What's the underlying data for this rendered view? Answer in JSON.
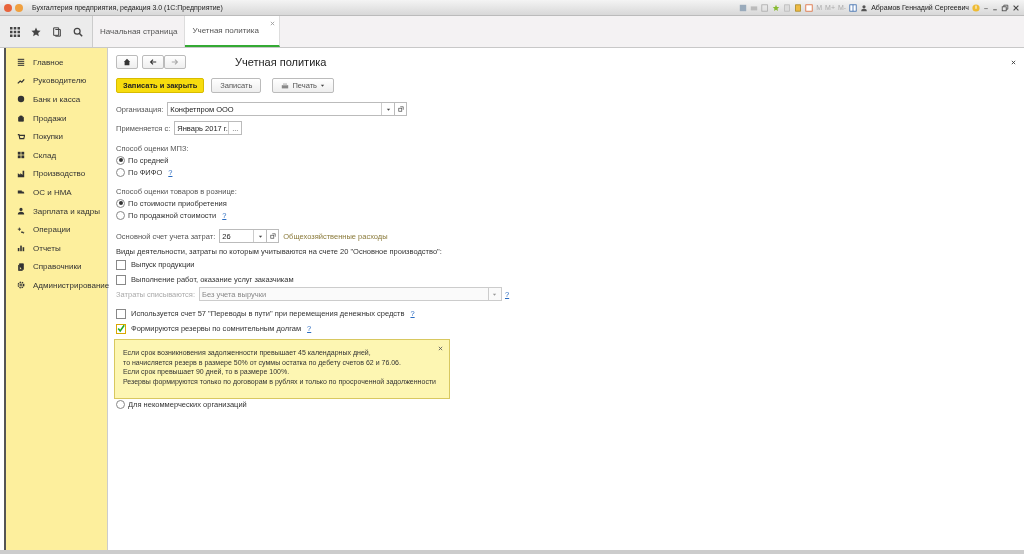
{
  "window": {
    "title": "Бухгалтерия предприятия, редакция 3.0  (1С:Предприятие)",
    "memory_buttons": [
      "M",
      "M+",
      "M-"
    ],
    "user": "Абрамов Геннадий Сергеевич"
  },
  "tabs": [
    {
      "label": "Начальная страница",
      "selected": false
    },
    {
      "label": "Учетная политика",
      "selected": true
    }
  ],
  "sidebar": {
    "items": [
      {
        "label": "Главное"
      },
      {
        "label": "Руководителю"
      },
      {
        "label": "Банк и касса"
      },
      {
        "label": "Продажи"
      },
      {
        "label": "Покупки"
      },
      {
        "label": "Склад"
      },
      {
        "label": "Производство"
      },
      {
        "label": "ОС и НМА"
      },
      {
        "label": "Зарплата и кадры"
      },
      {
        "label": "Операции"
      },
      {
        "label": "Отчеты"
      },
      {
        "label": "Справочники"
      },
      {
        "label": "Администрирование"
      }
    ]
  },
  "form": {
    "title": "Учетная политика",
    "buttons": {
      "save_close": "Записать и закрыть",
      "save": "Записать",
      "print": "Печать"
    },
    "organization": {
      "label": "Организация:",
      "value": "Конфетпром ООО"
    },
    "applies_from": {
      "label": "Применяется с:",
      "value": "Январь 2017 г.",
      "button": "..."
    },
    "mpz": {
      "label": "Способ оценки МПЗ:",
      "options": [
        {
          "label": "По средней",
          "selected": true
        },
        {
          "label": "По ФИФО",
          "selected": false,
          "help": "?"
        }
      ]
    },
    "retail": {
      "label": "Способ оценки товаров в рознице:",
      "options": [
        {
          "label": "По стоимости приобретения",
          "selected": true
        },
        {
          "label": "По продажной стоимости",
          "selected": false,
          "help": "?"
        }
      ]
    },
    "cost_account": {
      "label": "Основной счет учета затрат:",
      "value": "26",
      "description": "Общехозяйственные расходы"
    },
    "activities": {
      "label": "Виды деятельности, затраты по которым учитываются на счете 20 \"Основное производство\":",
      "checks": [
        {
          "label": "Выпуск продукции",
          "checked": false
        },
        {
          "label": "Выполнение работ, оказание услуг заказчикам",
          "checked": false
        }
      ],
      "writeoff": {
        "label": "Затраты списываются:",
        "value": "Без учета выручки",
        "disabled": true,
        "help": "?"
      }
    },
    "options": [
      {
        "label": "Используется счет 57 \"Переводы в пути\" при перемещения денежных средств",
        "checked": false,
        "help": "?"
      },
      {
        "label": "Формируются резервы по сомнительным долгам",
        "checked": true,
        "help": "?"
      }
    ],
    "tooltip": {
      "lines": [
        "Если срок возникновения задолженности превышает 45 календарных дней,",
        "то начисляется резерв в размере 50% от суммы остатка по дебету счетов 62 и 76.06.",
        "Если срок превышает 90 дней, то в размере 100%.",
        "Резервы формируются только по договорам в рублях и только по просроченной задолженности"
      ]
    },
    "nonprofit": {
      "label": "Для некоммерческих организаций",
      "selected": false
    }
  }
}
